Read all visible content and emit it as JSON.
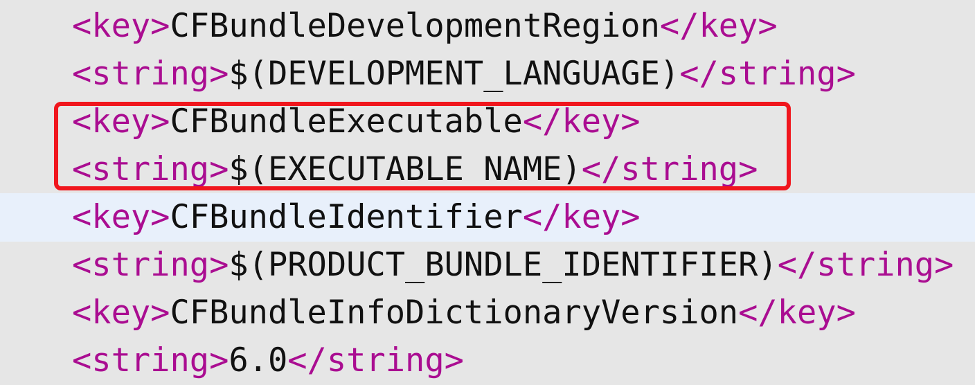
{
  "colors": {
    "background": "#e6e6e6",
    "current_line": "#e8f0fb",
    "tag": "#aa0d91",
    "text": "#111111",
    "highlight_border": "#f0161d"
  },
  "lines": [
    {
      "open": "<key>",
      "value": "CFBundleDevelopmentRegion",
      "close": "</key>"
    },
    {
      "open": "<string>",
      "value": "$(DEVELOPMENT_LANGUAGE)",
      "close": "</string>"
    },
    {
      "open": "<key>",
      "value": "CFBundleExecutable",
      "close": "</key>"
    },
    {
      "open": "<string>",
      "value": "$(EXECUTABLE_NAME)",
      "close": "</string>"
    },
    {
      "open": "<key>",
      "value": "CFBundleIdentifier",
      "close": "</key>"
    },
    {
      "open": "<string>",
      "value": "$(PRODUCT_BUNDLE_IDENTIFIER)",
      "close": "</string>"
    },
    {
      "open": "<key>",
      "value": "CFBundleInfoDictionaryVersion",
      "close": "</key>"
    },
    {
      "open": "<string>",
      "value": "6.0",
      "close": "</string>"
    }
  ]
}
